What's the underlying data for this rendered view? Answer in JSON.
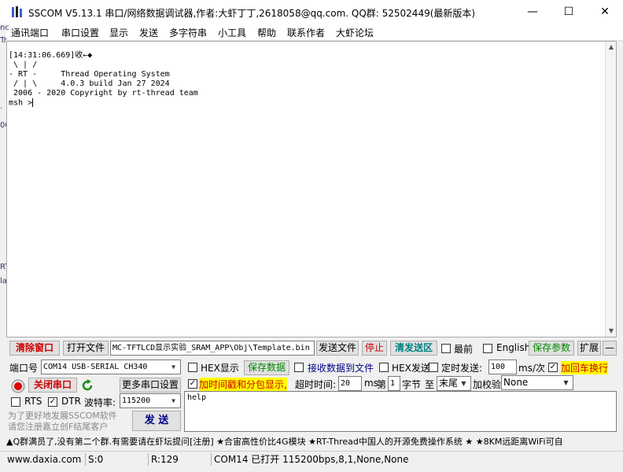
{
  "window": {
    "title": "SSCOM V5.13.1 串口/网络数据调试器,作者:大虾丁丁,2618058@qq.com. QQ群: 52502449(最新版本)",
    "minimize": "—",
    "maximize": "☐",
    "close": "✕"
  },
  "menu": [
    "通讯端口",
    "串口设置",
    "显示",
    "发送",
    "多字符串",
    "小工具",
    "帮助",
    "联系作者",
    "大虾论坛"
  ],
  "terminal": {
    "lines": "[14:31:06.669]收←◆\n \\ | /\n- RT -     Thread Operating System\n / | \\     4.0.3 build Jan 27 2024\n 2006 - 2020 Copyright by rt-thread team\nmsh >"
  },
  "edge_chars": [
    "nc",
    "Tr",
    ".",
    "00",
    "RT",
    "la"
  ],
  "toolbar": {
    "clear_window": "清除窗口",
    "open_file": "打开文件",
    "file_path": "MC-TFTLCD显示实验_SRAM_APP\\Obj\\Template.bin",
    "send_file": "发送文件",
    "stop": "停止",
    "clear_send": "清发送区",
    "topmost": "最前",
    "english": "English",
    "save_params": "保存参数",
    "expand": "扩展",
    "collapse": "—"
  },
  "port": {
    "port_label": "端口号",
    "port_value": "COM14 USB-SERIAL CH340",
    "close_port": "关闭串口",
    "more_settings": "更多串口设置",
    "rts_label": "RTS",
    "dtr_label": "DTR",
    "baud_label": "波特率:",
    "baud_value": "115200"
  },
  "options": {
    "hex_display": "HEX显示",
    "save_data": "保存数据",
    "recv_to_file": "接收数据到文件",
    "hex_send": "HEX发送",
    "timed_send": "定时发送:",
    "period_value": "100",
    "period_unit": "ms/次",
    "add_newline": "加回车换行",
    "add_timestamp": "加时间戳和分包显示,",
    "timeout_label": "超时时间:",
    "timeout_value": "20",
    "timeout_unit": "ms",
    "nth_label": "第",
    "nth_value": "1",
    "byte_label": "字节",
    "to_label": "至",
    "end_value": "末尾",
    "checksum_label": "加校验",
    "checksum_value": "None",
    "check_mark": "✓"
  },
  "send": {
    "text": "help",
    "button": "发 送",
    "hint1": "为了更好地发展SSCOM软件",
    "hint2": "请您注册嘉立创F结尾客户"
  },
  "ticker": "▲Q群满员了,没有第二个群.有需要请在虾坛提问[注册] ★合宙高性价比4G模块 ★RT-Thread中国人的开源免费操作系统 ★ ★8KM远距离WiFi可自",
  "status": {
    "website": "www.daxia.com",
    "sent": "S:0",
    "received": "R:129",
    "port_status": "COM14 已打开  115200bps,8,1,None,None"
  },
  "colors": {
    "highlight": "#ffff00",
    "red_text": "#cc0000",
    "green_text": "#008800"
  }
}
